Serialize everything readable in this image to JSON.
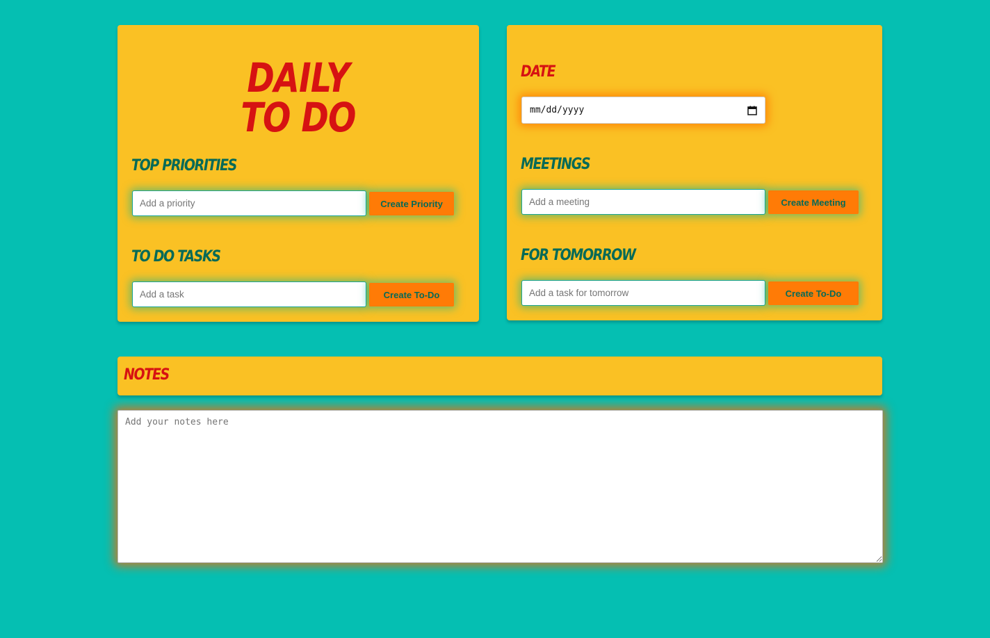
{
  "title": {
    "line1": "DAILY",
    "line2": "TO DO"
  },
  "priorities": {
    "heading": "TOP PRIORITIES",
    "placeholder": "Add a priority",
    "button": "Create Priority"
  },
  "tasks": {
    "heading": "TO DO TASKS",
    "placeholder": "Add a task",
    "button": "Create To-Do"
  },
  "date": {
    "heading": "DATE",
    "value_text": "mm/dd/yyyy"
  },
  "meetings": {
    "heading": "MEETINGS",
    "placeholder": "Add a meeting",
    "button": "Create Meeting"
  },
  "tomorrow": {
    "heading": "FOR TOMORROW",
    "placeholder": "Add a task for tomorrow",
    "button": "Create To-Do"
  },
  "notes": {
    "heading": "NOTES",
    "placeholder": "Add your notes here"
  },
  "colors": {
    "background": "#05bfb2",
    "card": "#fac124",
    "accent_red": "#d61212",
    "heading_green": "#066a57",
    "button_orange": "#ff7b06"
  }
}
